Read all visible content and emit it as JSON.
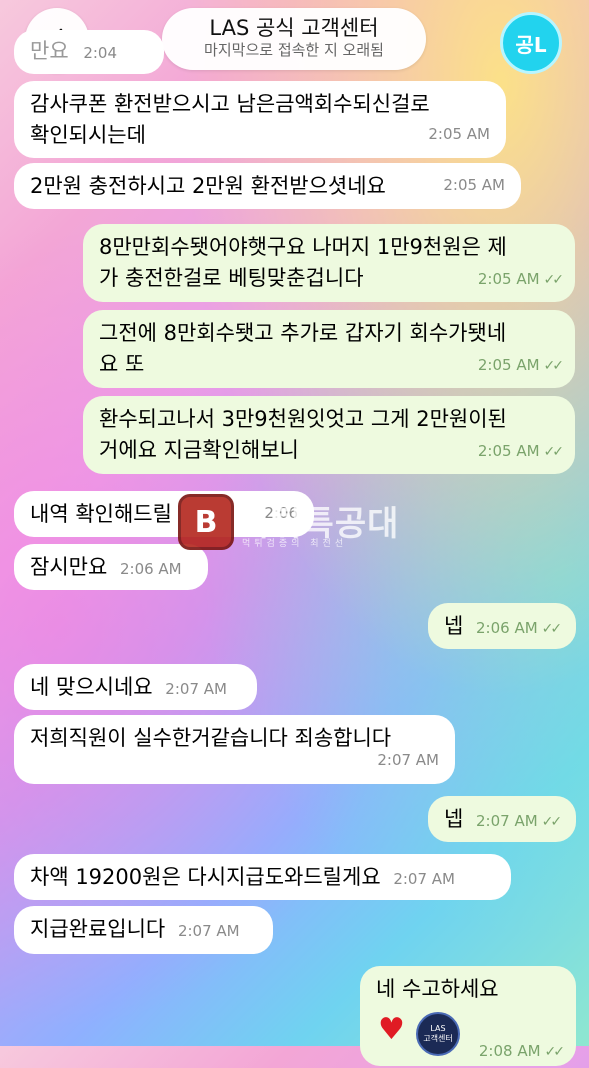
{
  "header": {
    "title": "LAS 공식 고객센터",
    "subtitle": "마지막으로 접속한 지 오래됨",
    "avatar_text": "공L",
    "back_icon": "chevron-left-icon"
  },
  "messages": [
    {
      "text": "만요",
      "time": "2:04"
    },
    {
      "text": "감사쿠폰 환전받으시고 남은금액회수되신걸로 확인되시는데",
      "line1": "감사쿠폰 환전받으시고 남은금액회수되신걸로",
      "line2": "확인되시는데",
      "time": "2:05 AM"
    },
    {
      "text": "2만원 충전하시고 2만원 환전받으셧네요",
      "time": "2:05 AM"
    },
    {
      "line1": "8만만회수됏어야햇구요 나머지 1만9천원은 제",
      "line2": "가 충전한걸로 베팅맞춘겁니다",
      "time": "2:05 AM"
    },
    {
      "line1": "그전에 8만회수됏고 추가로 갑자기 회수가됏네",
      "line2": "요 또",
      "time": "2:05 AM"
    },
    {
      "line1": "환수되고나서 3만9천원잇엇고 그게 2만원이된",
      "line2": "거에요 지금확인해보니",
      "time": "2:05 AM"
    },
    {
      "text": "내역 확인해드릴",
      "time": "2:06"
    },
    {
      "text": "잠시만요",
      "time": "2:06 AM"
    },
    {
      "text": "넵",
      "time": "2:06 AM"
    },
    {
      "text": "네 맞으시네요",
      "time": "2:07 AM"
    },
    {
      "text": "저희직원이 실수한거같습니다 죄송합니다",
      "time": "2:07 AM"
    },
    {
      "text": "넵",
      "time": "2:07 AM"
    },
    {
      "text": "차액 19200원은 다시지급도와드릴게요",
      "time": "2:07 AM"
    },
    {
      "text": "지급완료입니다",
      "time": "2:07 AM"
    },
    {
      "text": "네 수고하세요",
      "time": "2:08 AM"
    }
  ],
  "watermark": {
    "badge": "B",
    "text": "먹튀특공대",
    "sub": "먹튀검증의 최전선"
  },
  "sticker": {
    "logo_top": "LAS",
    "logo_bottom": "고객센터"
  },
  "colors": {
    "in_bubble": "#ffffff",
    "out_bubble": "#eefadf",
    "avatar": "#22d3ee",
    "watermark_badge": "#b3261e"
  }
}
